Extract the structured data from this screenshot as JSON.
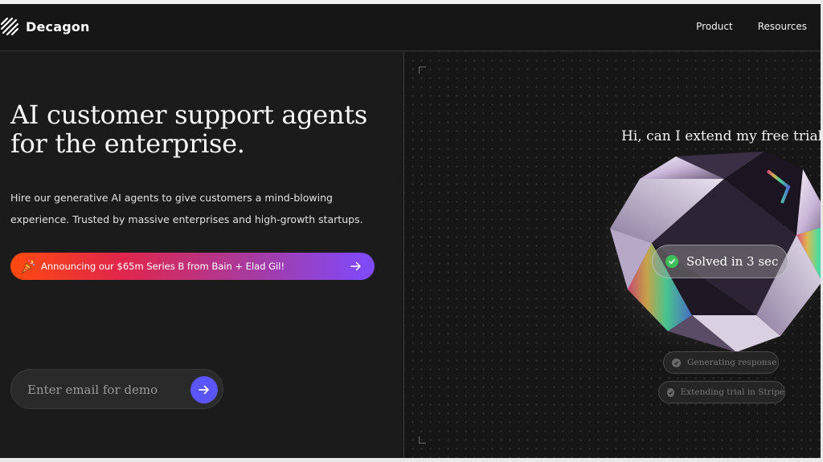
{
  "brand": {
    "name": "Decagon",
    "logo_icon": "decagon-logo-icon"
  },
  "nav": {
    "links": [
      {
        "label": "Product"
      },
      {
        "label": "Resources"
      }
    ]
  },
  "hero": {
    "title": "AI customer support agents for the enterprise.",
    "subtitle": "Hire our generative AI agents to give customers a mind-blowing experience. Trusted by massive enterprises and high-growth startups."
  },
  "announcement": {
    "text": "Announcing our $65m Series B from Bain + Elad Gil!",
    "icon": "party-popper-icon",
    "arrow_icon": "arrow-right-icon"
  },
  "demo": {
    "email_placeholder": "Enter email for demo",
    "submit_icon": "arrow-right-icon"
  },
  "showcase": {
    "question": "Hi, can I extend my free trial?",
    "status": "Solved in 3 sec",
    "steps": [
      {
        "label": "Generating response"
      },
      {
        "label": "Extending trial in Stripe"
      }
    ]
  },
  "colors": {
    "background": "#1a1a1a",
    "accent": "#5b55ff",
    "success": "#3fbf5a",
    "gradient_start": "#ff4a0f",
    "gradient_end": "#7e4bff"
  }
}
